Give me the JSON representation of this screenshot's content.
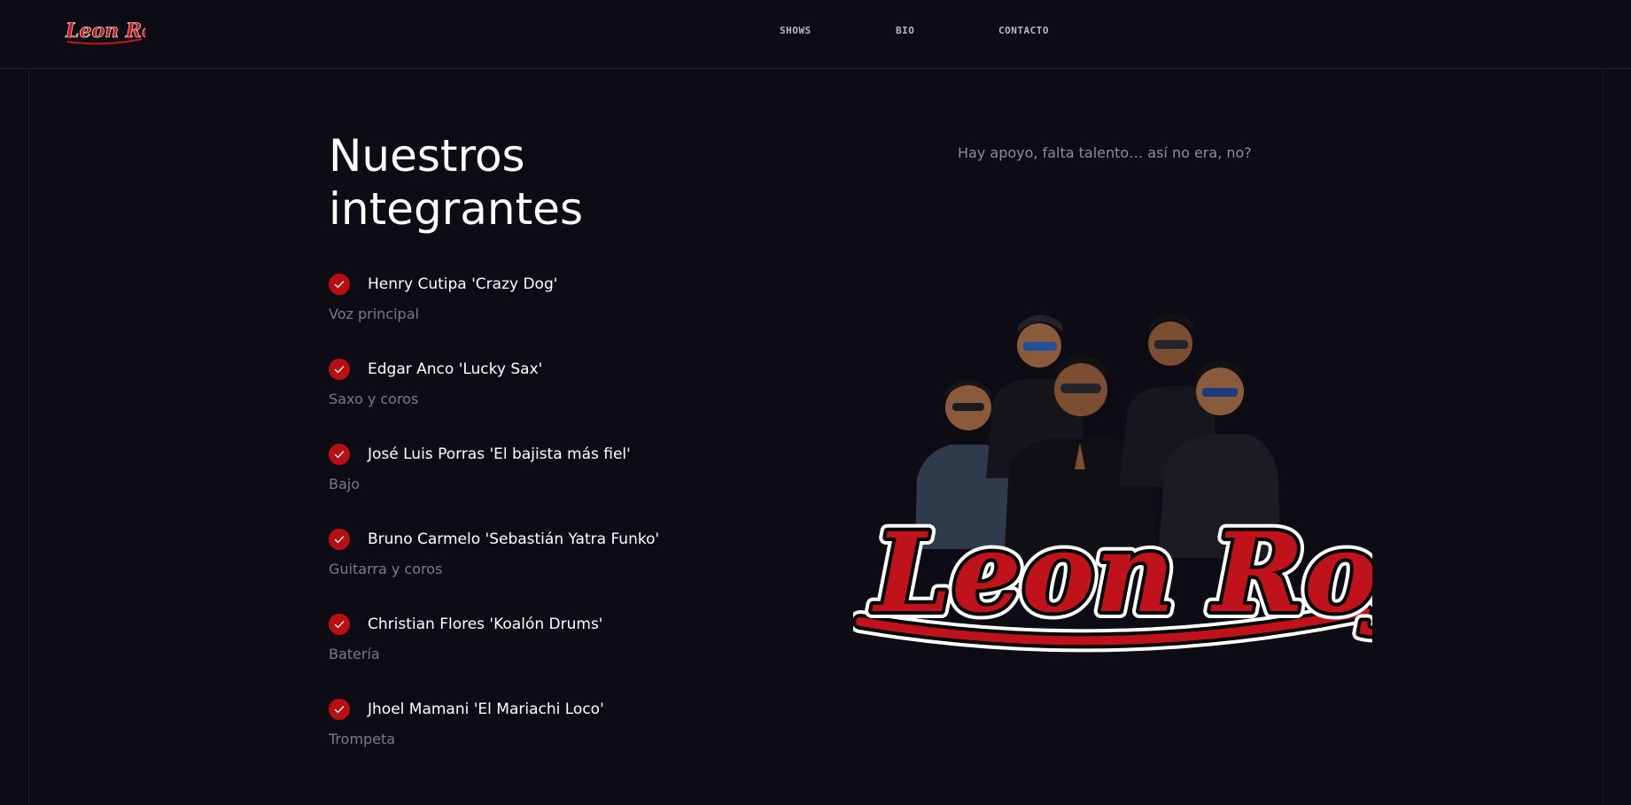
{
  "brand": {
    "logo_text": "Leon Rojo",
    "accent_color": "#b90f12"
  },
  "nav": {
    "items": [
      {
        "label": "SHOWS"
      },
      {
        "label": "BIO"
      },
      {
        "label": "CONTACTO"
      }
    ]
  },
  "main": {
    "title": "Nuestros integrantes",
    "tagline": "Hay apoyo, falta talento… así no era, no?",
    "members": [
      {
        "name": "Henry Cutipa 'Crazy Dog'",
        "role": "Voz principal"
      },
      {
        "name": "Edgar Anco 'Lucky Sax'",
        "role": "Saxo y coros"
      },
      {
        "name": "José Luis Porras 'El bajista más fiel'",
        "role": "Bajo"
      },
      {
        "name": "Bruno Carmelo 'Sebastián Yatra Funko'",
        "role": "Guitarra y coros"
      },
      {
        "name": "Christian Flores 'Koalón Drums'",
        "role": "Batería"
      },
      {
        "name": "Jhoel Mamani 'El Mariachi Loco'",
        "role": "Trompeta"
      }
    ],
    "band_image": {
      "logo_text": "Leon Rojo",
      "icon": "band-photo"
    }
  }
}
